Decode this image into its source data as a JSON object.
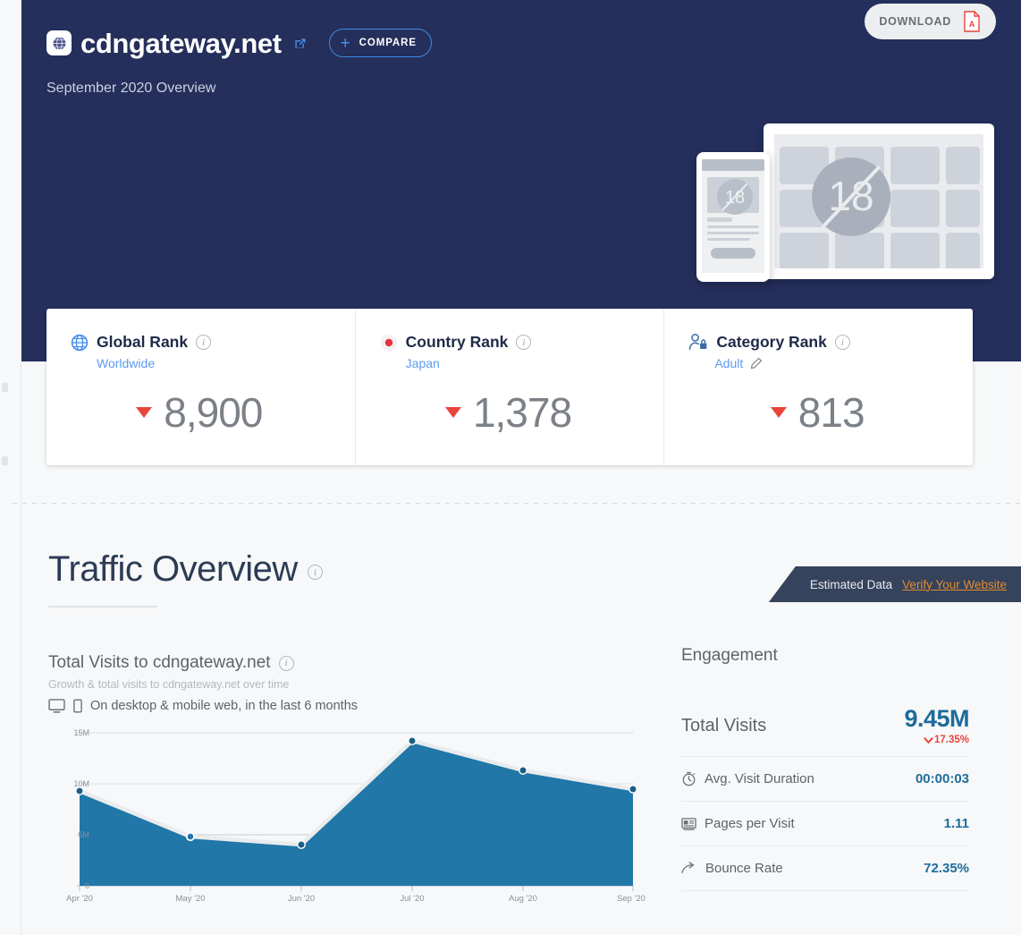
{
  "header": {
    "site_name": "cdngateway.net",
    "favicon_icon": "globe-icon",
    "external_link_icon": "external-link-icon",
    "compare_label": "COMPARE",
    "compare_plus": "+",
    "subtitle": "September 2020 Overview",
    "download_label": "DOWNLOAD",
    "download_icon": "pdf-icon",
    "bg_color": "#242f5c"
  },
  "illustration": {
    "badge_text": "18",
    "name": "adult-content-placeholder"
  },
  "ranks": [
    {
      "title": "Global Rank",
      "icon": "globe-icon",
      "sub": "Worldwide",
      "value": "8,900",
      "trend": "down",
      "info_icon": "info-icon"
    },
    {
      "title": "Country Rank",
      "icon": "japan-flag-icon",
      "sub": "Japan",
      "value": "1,378",
      "trend": "down",
      "info_icon": "info-icon"
    },
    {
      "title": "Category Rank",
      "icon": "category-lock-icon",
      "sub": "Adult",
      "edit_icon": "pencil-icon",
      "value": "813",
      "trend": "down",
      "info_icon": "info-icon"
    }
  ],
  "traffic": {
    "section_title": "Traffic Overview",
    "chart_title": "Total Visits to cdngateway.net",
    "chart_subtitle": "Growth & total visits to cdngateway.net over time",
    "chart_note": "On desktop & mobile web, in the last 6 months",
    "desktop_icon": "desktop-icon",
    "mobile_icon": "mobile-icon"
  },
  "ribbon": {
    "label": "Estimated Data",
    "link": "Verify Your Website",
    "link_color": "#e08b2e"
  },
  "engagement": {
    "heading": "Engagement",
    "total_label": "Total Visits",
    "total_value": "9.45M",
    "total_change": "17.35%",
    "total_change_direction": "down",
    "rows": [
      {
        "label": "Avg. Visit Duration",
        "value": "00:00:03",
        "icon": "stopwatch-icon"
      },
      {
        "label": "Pages per Visit",
        "value": "1.11",
        "icon": "pages-icon"
      },
      {
        "label": "Bounce Rate",
        "value": "72.35%",
        "icon": "bounce-arrow-icon"
      }
    ]
  },
  "chart_data": {
    "type": "area",
    "title": "Total Visits to cdngateway.net",
    "xlabel": "",
    "ylabel": "",
    "categories": [
      "Apr '20",
      "May '20",
      "Jun '20",
      "Jul '20",
      "Aug '20",
      "Sep '20"
    ],
    "values": [
      9300000,
      4800000,
      4000000,
      14200000,
      11300000,
      9450000
    ],
    "ytick_labels": [
      "0",
      "5M",
      "10M",
      "15M"
    ],
    "ytick_values": [
      0,
      5000000,
      10000000,
      15000000
    ],
    "ylim": [
      0,
      15000000
    ],
    "grid": true,
    "legend": "none",
    "series_color": "#2077a8",
    "marker_color": "#1b5f86"
  }
}
